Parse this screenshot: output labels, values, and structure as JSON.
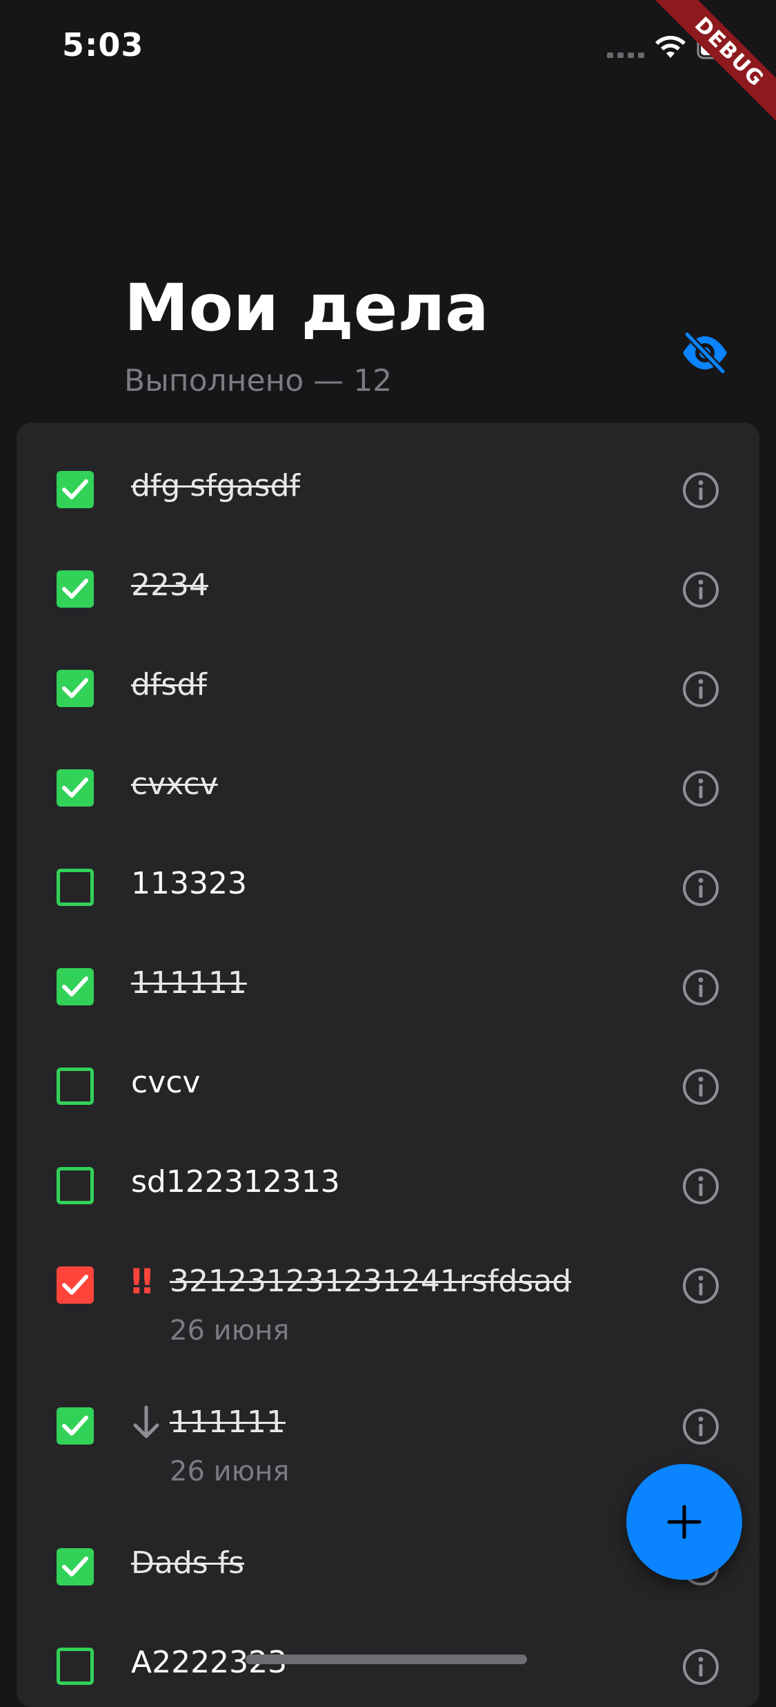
{
  "status_bar": {
    "time": "5:03"
  },
  "debug_banner": "DEBUG",
  "header": {
    "title": "Мои дела",
    "done_label": "Выполнено — 12",
    "visibility_icon": "eye-off-icon"
  },
  "colors": {
    "background": "#161618",
    "card": "#252528",
    "accent_blue": "#0a84ff",
    "check_green": "#32d158",
    "check_red": "#ff453a",
    "secondary_text": "#7b7b80"
  },
  "tasks": [
    {
      "text": "dfg sfgasdf",
      "done": true
    },
    {
      "text": "2234",
      "done": true
    },
    {
      "text": "dfsdf",
      "done": true
    },
    {
      "text": "cvxcv",
      "done": true
    },
    {
      "text": "113323",
      "done": false
    },
    {
      "text": "111111",
      "done": true
    },
    {
      "text": "cvcv",
      "done": false
    },
    {
      "text": "sd122312313",
      "done": false
    },
    {
      "text": "321231231231241rsfdsad",
      "done": true,
      "priority": "high",
      "prefix": "‼",
      "date": "26 июня"
    },
    {
      "text": "111111",
      "done": true,
      "priority": "low",
      "prefix_icon": "arrow-down-icon",
      "date": "26 июня"
    },
    {
      "text": "Dads fs",
      "done": true
    },
    {
      "text": "A2222323",
      "done": false
    }
  ],
  "fab": {
    "icon": "plus-icon"
  }
}
